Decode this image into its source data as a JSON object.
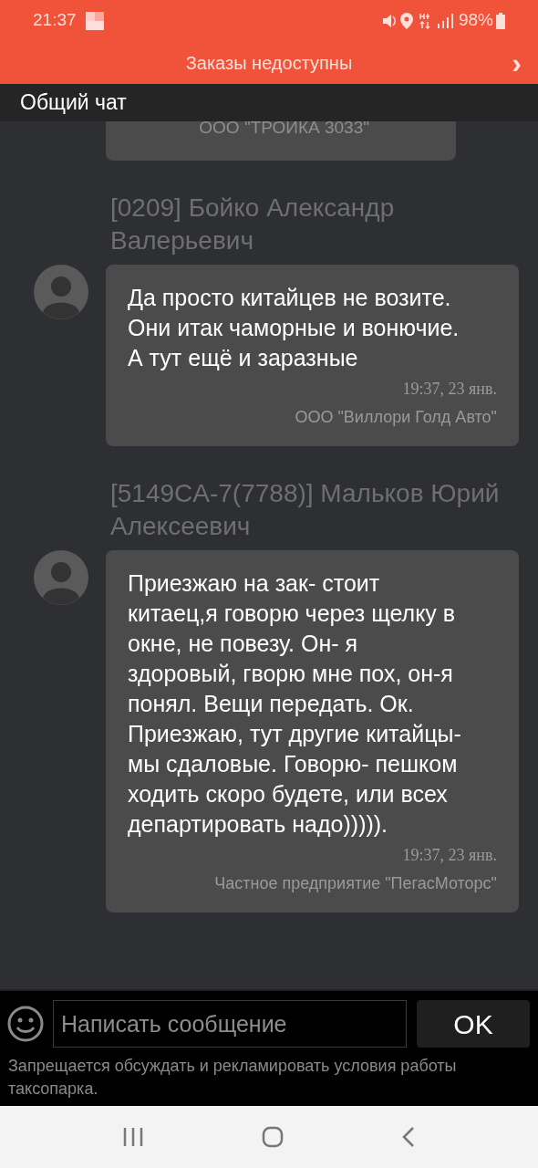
{
  "status_bar": {
    "time": "21:37",
    "battery": "98%"
  },
  "banner": {
    "text": "Заказы недоступны",
    "arrow": "›"
  },
  "chat": {
    "title": "Общий чат",
    "messages": [
      {
        "partial": true,
        "company": "ООО \"ТРОИКА 3033\""
      },
      {
        "partial": false,
        "sender": "[0209] Бойко Александр Валерьевич",
        "text": "Да просто китайцев не возите. Они итак чаморные и вонючие. А тут ещё и заразные",
        "time": "19:37, 23 янв.",
        "company": "ООО \"Виллори Голд Авто\""
      },
      {
        "partial": false,
        "sender": "[5149CA-7(7788)] Мальков Юрий Алексеевич",
        "text": "Приезжаю на зак- стоит китаец,я говорю через щелку в окне, не повезу. Он- я здоровый, гворю мне пох, он-я понял. Вещи передать. Ок. Приезжаю, тут другие китайцы- мы сдаловые. Говорю- пешком ходить скоро будете, или всех департировать надо))))).",
        "time": "19:37, 23 янв.",
        "company": "Частное предприятие \"ПегасМоторс\""
      }
    ]
  },
  "composer": {
    "placeholder": "Написать сообщение",
    "send": "OK",
    "notice": "Запрещается обсуждать и рекламировать условия работы таксопарка."
  }
}
